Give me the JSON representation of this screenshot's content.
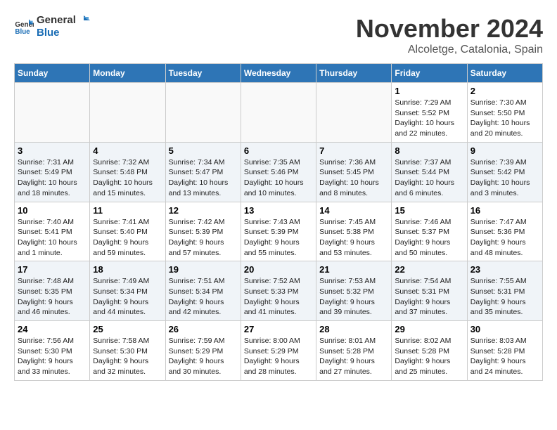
{
  "header": {
    "logo_line1": "General",
    "logo_line2": "Blue",
    "month_title": "November 2024",
    "location": "Alcoletge, Catalonia, Spain"
  },
  "weekdays": [
    "Sunday",
    "Monday",
    "Tuesday",
    "Wednesday",
    "Thursday",
    "Friday",
    "Saturday"
  ],
  "weeks": [
    [
      {
        "day": "",
        "info": ""
      },
      {
        "day": "",
        "info": ""
      },
      {
        "day": "",
        "info": ""
      },
      {
        "day": "",
        "info": ""
      },
      {
        "day": "",
        "info": ""
      },
      {
        "day": "1",
        "info": "Sunrise: 7:29 AM\nSunset: 5:52 PM\nDaylight: 10 hours\nand 22 minutes."
      },
      {
        "day": "2",
        "info": "Sunrise: 7:30 AM\nSunset: 5:50 PM\nDaylight: 10 hours\nand 20 minutes."
      }
    ],
    [
      {
        "day": "3",
        "info": "Sunrise: 7:31 AM\nSunset: 5:49 PM\nDaylight: 10 hours\nand 18 minutes."
      },
      {
        "day": "4",
        "info": "Sunrise: 7:32 AM\nSunset: 5:48 PM\nDaylight: 10 hours\nand 15 minutes."
      },
      {
        "day": "5",
        "info": "Sunrise: 7:34 AM\nSunset: 5:47 PM\nDaylight: 10 hours\nand 13 minutes."
      },
      {
        "day": "6",
        "info": "Sunrise: 7:35 AM\nSunset: 5:46 PM\nDaylight: 10 hours\nand 10 minutes."
      },
      {
        "day": "7",
        "info": "Sunrise: 7:36 AM\nSunset: 5:45 PM\nDaylight: 10 hours\nand 8 minutes."
      },
      {
        "day": "8",
        "info": "Sunrise: 7:37 AM\nSunset: 5:44 PM\nDaylight: 10 hours\nand 6 minutes."
      },
      {
        "day": "9",
        "info": "Sunrise: 7:39 AM\nSunset: 5:42 PM\nDaylight: 10 hours\nand 3 minutes."
      }
    ],
    [
      {
        "day": "10",
        "info": "Sunrise: 7:40 AM\nSunset: 5:41 PM\nDaylight: 10 hours\nand 1 minute."
      },
      {
        "day": "11",
        "info": "Sunrise: 7:41 AM\nSunset: 5:40 PM\nDaylight: 9 hours\nand 59 minutes."
      },
      {
        "day": "12",
        "info": "Sunrise: 7:42 AM\nSunset: 5:39 PM\nDaylight: 9 hours\nand 57 minutes."
      },
      {
        "day": "13",
        "info": "Sunrise: 7:43 AM\nSunset: 5:39 PM\nDaylight: 9 hours\nand 55 minutes."
      },
      {
        "day": "14",
        "info": "Sunrise: 7:45 AM\nSunset: 5:38 PM\nDaylight: 9 hours\nand 53 minutes."
      },
      {
        "day": "15",
        "info": "Sunrise: 7:46 AM\nSunset: 5:37 PM\nDaylight: 9 hours\nand 50 minutes."
      },
      {
        "day": "16",
        "info": "Sunrise: 7:47 AM\nSunset: 5:36 PM\nDaylight: 9 hours\nand 48 minutes."
      }
    ],
    [
      {
        "day": "17",
        "info": "Sunrise: 7:48 AM\nSunset: 5:35 PM\nDaylight: 9 hours\nand 46 minutes."
      },
      {
        "day": "18",
        "info": "Sunrise: 7:49 AM\nSunset: 5:34 PM\nDaylight: 9 hours\nand 44 minutes."
      },
      {
        "day": "19",
        "info": "Sunrise: 7:51 AM\nSunset: 5:34 PM\nDaylight: 9 hours\nand 42 minutes."
      },
      {
        "day": "20",
        "info": "Sunrise: 7:52 AM\nSunset: 5:33 PM\nDaylight: 9 hours\nand 41 minutes."
      },
      {
        "day": "21",
        "info": "Sunrise: 7:53 AM\nSunset: 5:32 PM\nDaylight: 9 hours\nand 39 minutes."
      },
      {
        "day": "22",
        "info": "Sunrise: 7:54 AM\nSunset: 5:31 PM\nDaylight: 9 hours\nand 37 minutes."
      },
      {
        "day": "23",
        "info": "Sunrise: 7:55 AM\nSunset: 5:31 PM\nDaylight: 9 hours\nand 35 minutes."
      }
    ],
    [
      {
        "day": "24",
        "info": "Sunrise: 7:56 AM\nSunset: 5:30 PM\nDaylight: 9 hours\nand 33 minutes."
      },
      {
        "day": "25",
        "info": "Sunrise: 7:58 AM\nSunset: 5:30 PM\nDaylight: 9 hours\nand 32 minutes."
      },
      {
        "day": "26",
        "info": "Sunrise: 7:59 AM\nSunset: 5:29 PM\nDaylight: 9 hours\nand 30 minutes."
      },
      {
        "day": "27",
        "info": "Sunrise: 8:00 AM\nSunset: 5:29 PM\nDaylight: 9 hours\nand 28 minutes."
      },
      {
        "day": "28",
        "info": "Sunrise: 8:01 AM\nSunset: 5:28 PM\nDaylight: 9 hours\nand 27 minutes."
      },
      {
        "day": "29",
        "info": "Sunrise: 8:02 AM\nSunset: 5:28 PM\nDaylight: 9 hours\nand 25 minutes."
      },
      {
        "day": "30",
        "info": "Sunrise: 8:03 AM\nSunset: 5:28 PM\nDaylight: 9 hours\nand 24 minutes."
      }
    ]
  ]
}
